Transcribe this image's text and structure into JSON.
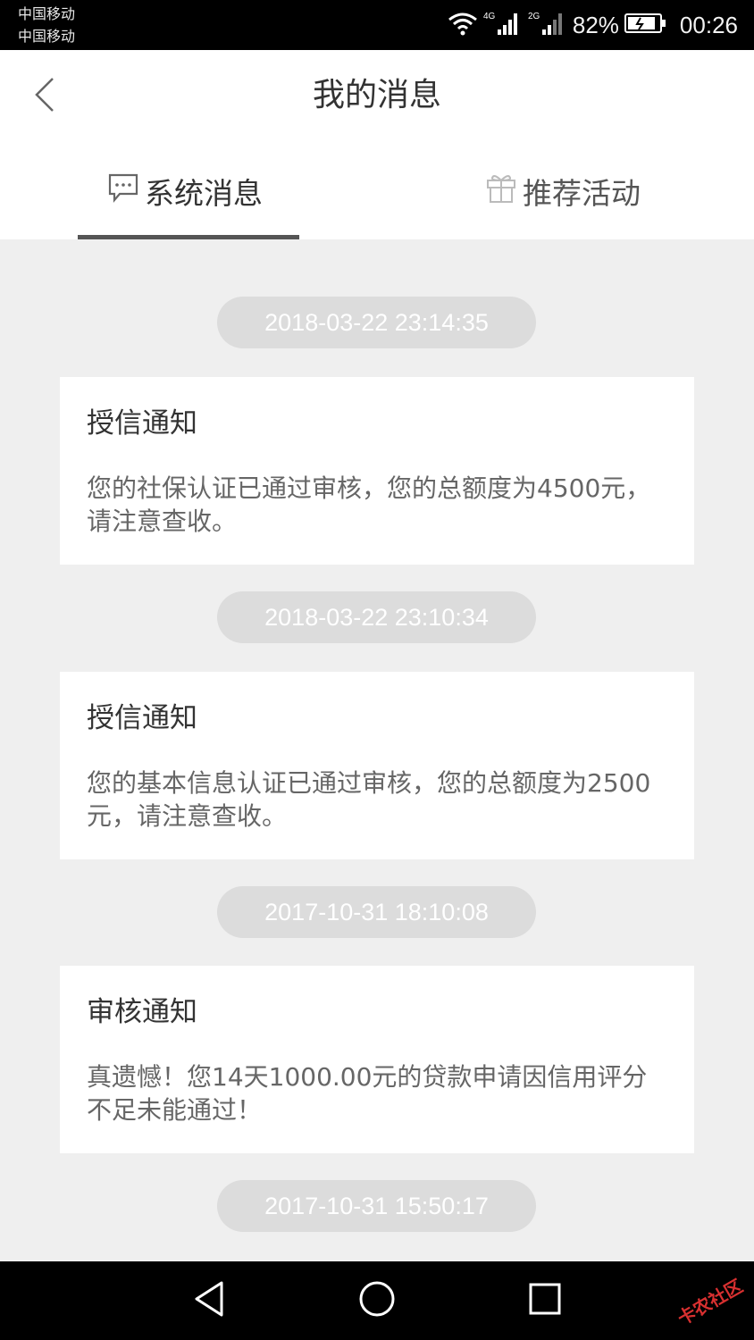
{
  "status_bar": {
    "carrier_1": "中国移动",
    "carrier_2": "中国移动",
    "network_1": "4G",
    "network_2": "2G",
    "battery": "82%",
    "time": "00:26"
  },
  "header": {
    "title": "我的消息",
    "tabs": [
      {
        "label": "系统消息",
        "icon": "chat-bubble-icon",
        "active": true
      },
      {
        "label": "推荐活动",
        "icon": "gift-icon",
        "active": false
      }
    ]
  },
  "messages": [
    {
      "time": "2018-03-22 23:14:35",
      "title": "授信通知",
      "body": "您的社保认证已通过审核，您的总额度为4500元，请注意查收。"
    },
    {
      "time": "2018-03-22 23:10:34",
      "title": "授信通知",
      "body": "您的基本信息认证已通过审核，您的总额度为2500元，请注意查收。"
    },
    {
      "time": "2017-10-31 18:10:08",
      "title": "审核通知",
      "body": "真遗憾！您14天1000.00元的贷款申请因信用评分不足未能通过！"
    },
    {
      "time": "2017-10-31 15:50:17"
    }
  ],
  "watermark": "卡农社区",
  "colors": {
    "background": "#efefef",
    "card": "#ffffff",
    "pill": "#dcdcdc",
    "title_text": "#333333",
    "body_text": "#666666"
  }
}
